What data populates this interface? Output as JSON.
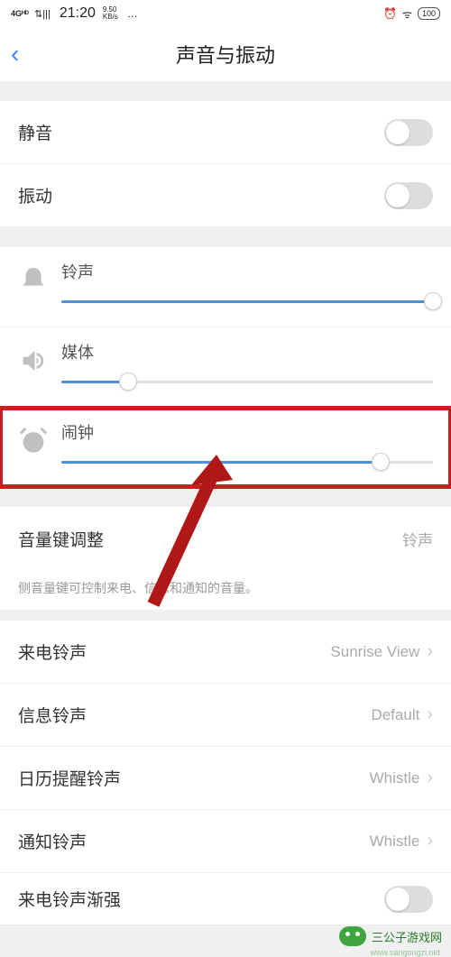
{
  "status_bar": {
    "network": "4Gᴴᴰ",
    "signal": "⇅|||",
    "time": "21:20",
    "kbs_top": "9.50",
    "kbs_bot": "KB/s",
    "dots": "…",
    "alarm_icon": "⏰",
    "wifi_icon": "ᯤ",
    "battery": "100"
  },
  "nav": {
    "back": "‹",
    "title": "声音与振动"
  },
  "toggles": {
    "mute_label": "静音",
    "vibrate_label": "振动"
  },
  "sliders": {
    "ring": {
      "label": "铃声",
      "percent": 100
    },
    "media": {
      "label": "媒体",
      "percent": 18
    },
    "alarm": {
      "label": "闹钟",
      "percent": 86
    }
  },
  "volume_key": {
    "label": "音量键调整",
    "value": "铃声",
    "desc": "侧音量键可控制来电、信息和通知的音量。"
  },
  "ringtones": {
    "incoming": {
      "label": "来电铃声",
      "value": "Sunrise View"
    },
    "message": {
      "label": "信息铃声",
      "value": "Default"
    },
    "calendar": {
      "label": "日历提醒铃声",
      "value": "Whistle"
    },
    "notification": {
      "label": "通知铃声",
      "value": "Whistle"
    },
    "ascending": {
      "label": "来电铃声渐强"
    }
  },
  "watermark": {
    "text": "三公子游戏网",
    "url": "www.sangongzi.net"
  }
}
